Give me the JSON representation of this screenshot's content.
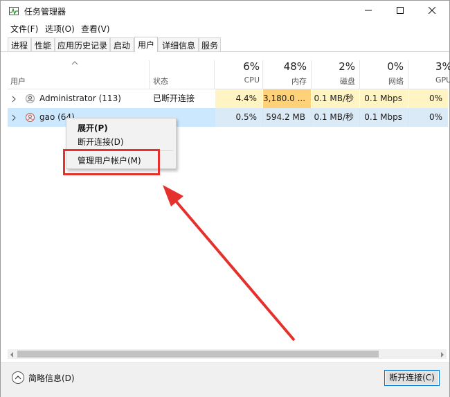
{
  "window": {
    "title": "任务管理器"
  },
  "menu": [
    "文件(F)",
    "选项(O)",
    "查看(V)"
  ],
  "tabs": [
    "进程",
    "性能",
    "应用历史记录",
    "启动",
    "用户",
    "详细信息",
    "服务"
  ],
  "active_tab": "用户",
  "columns": {
    "user": "用户",
    "status": "状态",
    "cpu": {
      "pct": "6%",
      "label": "CPU"
    },
    "memory": {
      "pct": "48%",
      "label": "内存"
    },
    "disk": {
      "pct": "2%",
      "label": "磁盘"
    },
    "network": {
      "pct": "0%",
      "label": "网络"
    },
    "gpu": {
      "pct": "3%",
      "label": "GPU"
    }
  },
  "rows": [
    {
      "name": "Administrator (113)",
      "status": "已断开连接",
      "cpu": "4.4%",
      "memory": "3,180.0 ...",
      "disk": "0.1 MB/秒",
      "network": "0.1 Mbps",
      "gpu": "0%"
    },
    {
      "name": "gao (64)",
      "status": "",
      "cpu": "0.5%",
      "memory": "594.2 MB",
      "disk": "0.1 MB/秒",
      "network": "0.1 Mbps",
      "gpu": "0%"
    }
  ],
  "context_menu": {
    "expand": "展开(P)",
    "disconnect": "断开连接(D)",
    "manage_accounts": "管理用户帐户(M)"
  },
  "footer": {
    "fewer_details": "简略信息(D)",
    "disconnect_button": "断开连接(C)"
  },
  "colors": {
    "annotation_red": "#e5312d",
    "selected_row": "#cce8ff",
    "heat_high": "#ffd27a",
    "heat_low": "#fff4c4"
  },
  "icons": [
    "task-manager-icon",
    "minimize-icon",
    "maximize-icon",
    "close-icon",
    "sort-up-icon",
    "chevron-right-icon",
    "user-icon",
    "chevron-up-icon"
  ]
}
